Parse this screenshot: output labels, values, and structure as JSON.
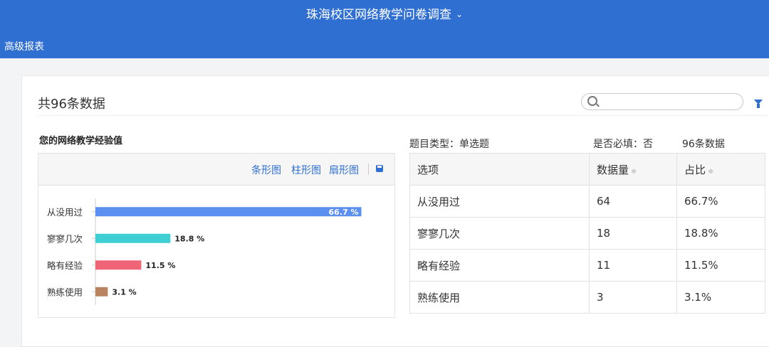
{
  "header": {
    "title": "珠海校区网络教学问卷调查",
    "subnav": "高级报表"
  },
  "summary": {
    "total": "共96条数据",
    "search_placeholder": ""
  },
  "question": {
    "title": "您的网络教学经验值",
    "type": "题目类型：单选题",
    "required": "是否必填：否",
    "count": "96条数据"
  },
  "chart_toolbar": {
    "bar": "条形图",
    "column": "柱形图",
    "pie": "扇形图"
  },
  "table": {
    "headers": [
      "选项",
      "数据量",
      "占比"
    ],
    "rows": [
      [
        "从没用过",
        "64",
        "66.7%"
      ],
      [
        "寥寥几次",
        "18",
        "18.8%"
      ],
      [
        "略有经验",
        "11",
        "11.5%"
      ],
      [
        "熟练使用",
        "3",
        "3.1%"
      ]
    ]
  },
  "chart_data": {
    "type": "bar",
    "orientation": "horizontal",
    "categories": [
      "从没用过",
      "寥寥几次",
      "略有经验",
      "熟练使用"
    ],
    "values": [
      66.7,
      18.8,
      11.5,
      3.1
    ],
    "labels": [
      "66.7 %",
      "18.8 %",
      "11.5 %",
      "3.1 %"
    ],
    "colors": [
      "#5b8ff0",
      "#3ecfd4",
      "#ef6577",
      "#b8835e"
    ],
    "xlim": [
      0,
      100
    ]
  }
}
